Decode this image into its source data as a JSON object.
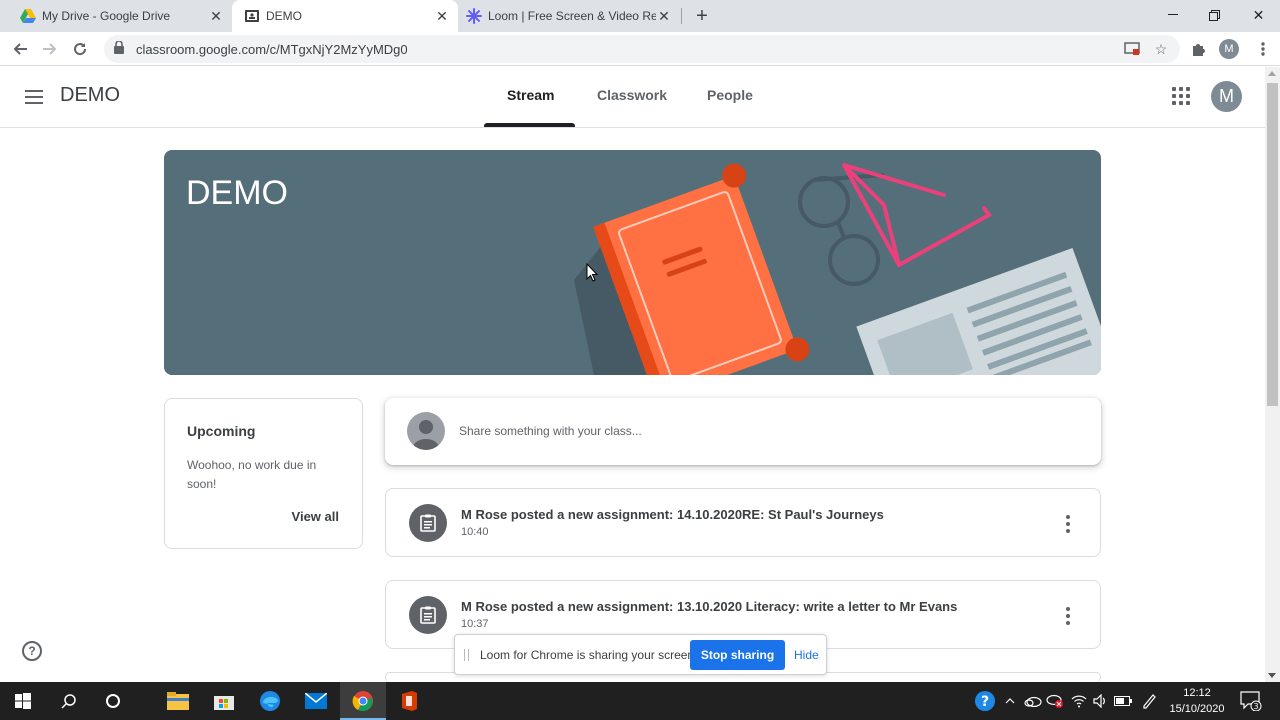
{
  "browser": {
    "tabs": [
      {
        "title": "My Drive - Google Drive",
        "icon": "google-drive-icon"
      },
      {
        "title": "DEMO",
        "icon": "classroom-icon",
        "active": true
      },
      {
        "title": "Loom | Free Screen & Video Reco",
        "icon": "loom-icon"
      }
    ],
    "url": "classroom.google.com/c/MTgxNjY2MzYyMDg0",
    "profile_initial": "M"
  },
  "classroom": {
    "class_name": "DEMO",
    "tabs": [
      "Stream",
      "Classwork",
      "People"
    ],
    "active_tab": "Stream",
    "avatar_initial": "M",
    "banner_title": "DEMO"
  },
  "upcoming": {
    "heading": "Upcoming",
    "message": "Woohoo, no work due in soon!",
    "view_all": "View all"
  },
  "share": {
    "placeholder": "Share something with your class..."
  },
  "posts": [
    {
      "text": "M Rose posted a new assignment: 14.10.2020RE: St Paul's Journeys",
      "time": "10:40"
    },
    {
      "text": "M Rose posted a new assignment: 13.10.2020 Literacy: write a letter to Mr Evans",
      "time": "10:37"
    }
  ],
  "loom": {
    "message": "Loom for Chrome is sharing your screen.",
    "stop_label": "Stop sharing",
    "hide_label": "Hide"
  },
  "taskbar": {
    "time": "12:12",
    "date": "15/10/2020",
    "notification_count": "3"
  },
  "colors": {
    "banner": "#546e7a",
    "accent_blue": "#1a73e8",
    "book_orange": "#ff7043"
  }
}
